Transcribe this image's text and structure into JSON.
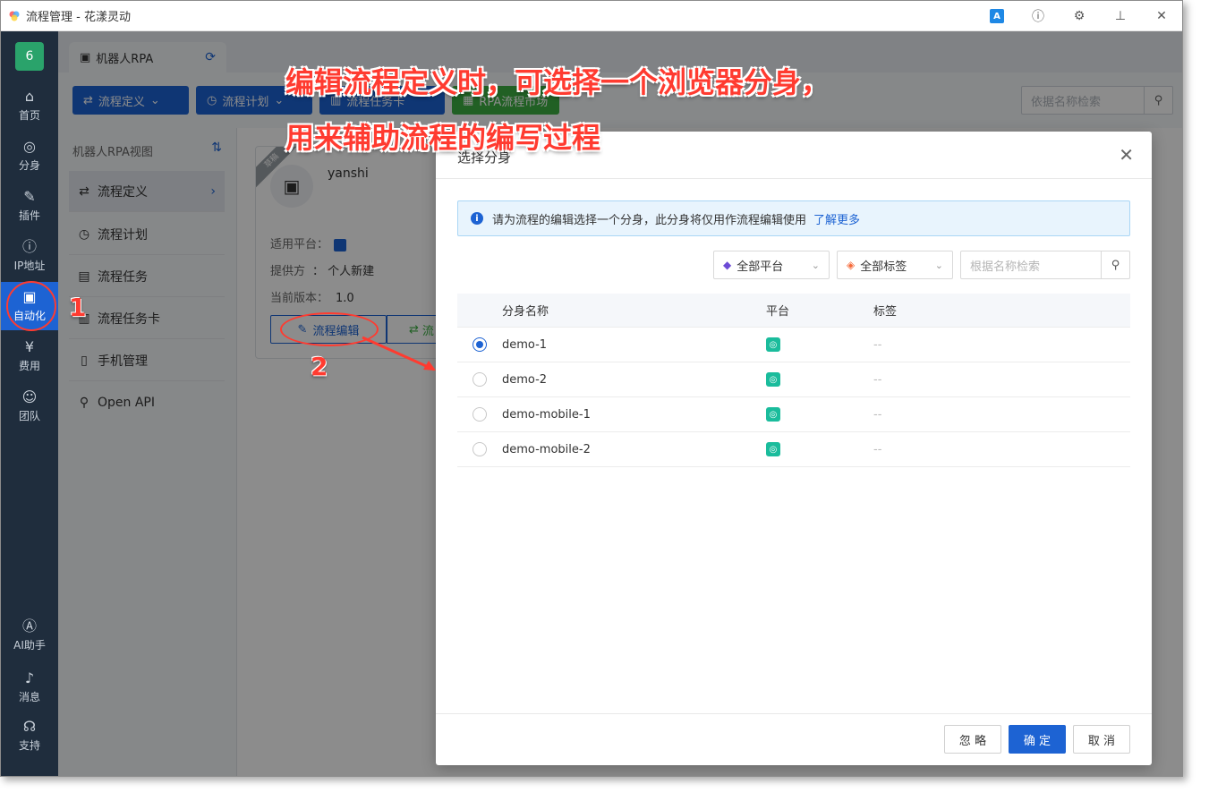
{
  "window": {
    "title": "流程管理 - 花漾灵动"
  },
  "titlebar_icons": [
    "translate-icon",
    "help-icon",
    "settings-icon",
    "pin-icon",
    "close-icon"
  ],
  "translate_label": "A",
  "leftnav": {
    "badge": "6",
    "items": [
      {
        "label": "首页",
        "icon": "⌂"
      },
      {
        "label": "分身",
        "icon": "◎"
      },
      {
        "label": "插件",
        "icon": "✎"
      },
      {
        "label": "IP地址",
        "icon": "ⓘ"
      },
      {
        "label": "自动化",
        "icon": "▣"
      },
      {
        "label": "费用",
        "icon": "¥"
      },
      {
        "label": "团队",
        "icon": "☺"
      }
    ],
    "bottom": [
      {
        "label": "AI助手",
        "icon": "Ⓐ"
      },
      {
        "label": "消息",
        "icon": "♪"
      },
      {
        "label": "支持",
        "icon": "☊"
      }
    ]
  },
  "tab": {
    "label": "机器人RPA"
  },
  "toolbar": {
    "btn1": "流程定义",
    "btn2": "流程计划",
    "btn3": "流程任务卡",
    "btn4": "RPA流程市场",
    "search_placeholder": "依据名称检索"
  },
  "sidepanel": {
    "title": "机器人RPA视图",
    "items": [
      {
        "label": "流程定义",
        "icon": "⇄"
      },
      {
        "label": "流程计划",
        "icon": "◷"
      },
      {
        "label": "流程任务",
        "icon": "▤"
      },
      {
        "label": "流程任务卡",
        "icon": "▥"
      },
      {
        "label": "手机管理",
        "icon": "▯"
      },
      {
        "label": "Open API",
        "icon": "⚲"
      }
    ]
  },
  "card": {
    "ribbon": "草稿",
    "name": "yanshi",
    "platform_label": "适用平台：",
    "provider_label": "提供方",
    "provider_value": "：  个人新建",
    "version_label": "当前版本：",
    "version_value": "1.0",
    "edit_label": "流程编辑",
    "second_label": "流"
  },
  "modal": {
    "title": "选择分身",
    "alert_text": "请为流程的编辑选择一个分身，此分身将仅用作流程编辑使用",
    "alert_link": "了解更多",
    "filter_platform": "全部平台",
    "filter_tags": "全部标签",
    "search_placeholder": "根据名称检索",
    "columns": {
      "name": "分身名称",
      "platform": "平台",
      "tags": "标签"
    },
    "rows": [
      {
        "name": "demo-1",
        "tags": "--",
        "checked": true
      },
      {
        "name": "demo-2",
        "tags": "--",
        "checked": false
      },
      {
        "name": "demo-mobile-1",
        "tags": "--",
        "checked": false
      },
      {
        "name": "demo-mobile-2",
        "tags": "--",
        "checked": false
      }
    ],
    "footer": {
      "ignore": "忽 略",
      "ok": "确 定",
      "cancel": "取 消"
    }
  },
  "annotations": {
    "line1": "编辑流程定义时，可选择一个浏览器分身，",
    "line2": "用来辅助流程的编写过程",
    "num1": "1",
    "num2": "2"
  },
  "colors": {
    "accent": "#1d63d3",
    "nav_bg": "#1f2d3d",
    "annotation": "#ff3b30",
    "market_green": "#3cb043"
  }
}
